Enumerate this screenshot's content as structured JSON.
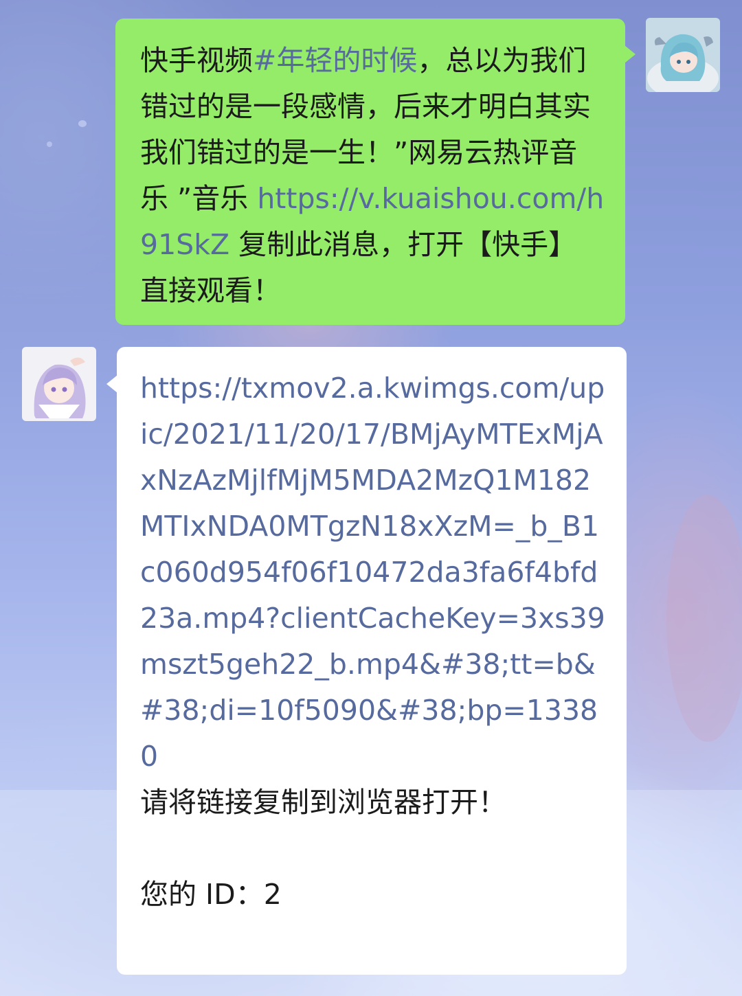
{
  "colors": {
    "sent_bubble": "#95ec69",
    "received_bubble": "#ffffff",
    "link": "#566a9e",
    "text": "#1b1b1b"
  },
  "messages": [
    {
      "direction": "sent",
      "avatar_icon": "anime-girl-blue-hair-avatar-icon",
      "text_prefix": "快手视频",
      "hashtag": "#年轻的时候",
      "text_middle": "，总以为我们错过的是一段感情，后来才明白其实我们错过的是一生！”网易云热评音乐 ”音乐 ",
      "link": "https://v.kuaishou.com/h91SkZ",
      "text_suffix": " 复制此消息，打开【快手】直接观看！"
    },
    {
      "direction": "received",
      "avatar_icon": "anime-girl-lavender-hair-avatar-icon",
      "link": "https://txmov2.a.kwimgs.com/upic/2021/11/20/17/BMjAyMTExMjAxNzAzMjlfMjM5MDA2MzQ1M182MTIxNDA0MTgzN18xXzM=_b_B1c060d954f06f10472da3fa6f4bfd23a.mp4?clientCacheKey=3xs39mszt5geh22_b.mp4&#38;tt=b&#38;di=10f5090&#38;bp=13380",
      "instruction": "请将链接复制到浏览器打开！",
      "id_line": "您的 ID：2"
    }
  ]
}
